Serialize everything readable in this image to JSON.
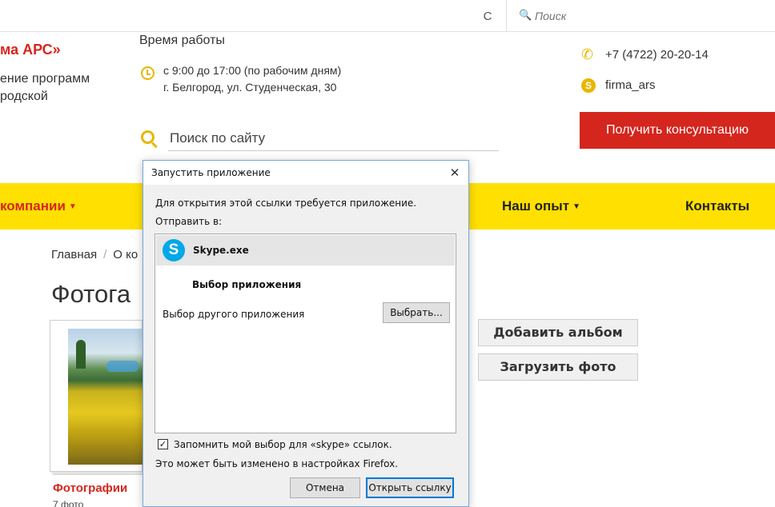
{
  "browser": {
    "reload_glyph": "C",
    "search_glyph": "🔍",
    "search_placeholder": "Поиск"
  },
  "header": {
    "brand_title": "ма АРС»",
    "brand_lines": [
      "ение программ",
      "родской"
    ],
    "work_title": "Время работы",
    "work_hours": "с 9:00 до 17:00 (по рабочим дням)",
    "address": "г. Белгород, ул. Студенческая, 30",
    "phone": "+7 (4722) 20-20-14",
    "skype": "firma_ars",
    "site_search_placeholder": "Поиск по сайту",
    "consult_button": "Получить консультацию"
  },
  "nav": {
    "company": "компании",
    "experience": "Наш опыт",
    "contacts": "Контакты",
    "caret": "▼"
  },
  "content": {
    "breadcrumb_home": "Главная",
    "breadcrumb_sep": "/",
    "breadcrumb_current": "О ко",
    "page_title": "Фотога",
    "album_name": "Фотографии",
    "album_count": "7 фото",
    "add_album_button": "Добавить альбом",
    "upload_photo_button": "Загрузить фото"
  },
  "dialog": {
    "title": "Запустить приложение",
    "close_glyph": "✕",
    "message": "Для открытия этой ссылки требуется приложение.",
    "send_to": "Отправить в:",
    "skype_app": "Skype.exe",
    "skype_letter": "S",
    "choose_heading": "Выбор приложения",
    "other_app": "Выбор другого приложения",
    "choose_button": "Выбрать...",
    "remember": "Запомнить мой выбор для «skype» ссылок.",
    "remember_checked": "✓",
    "note": "Это может быть изменено в настройках Firefox.",
    "cancel_button": "Отмена",
    "open_button": "Открыть ссылку"
  },
  "colors": {
    "brand_red": "#d4261d",
    "nav_yellow": "#ffe000",
    "accent_yellow": "#e8b600",
    "skype_blue": "#00a8e8"
  }
}
